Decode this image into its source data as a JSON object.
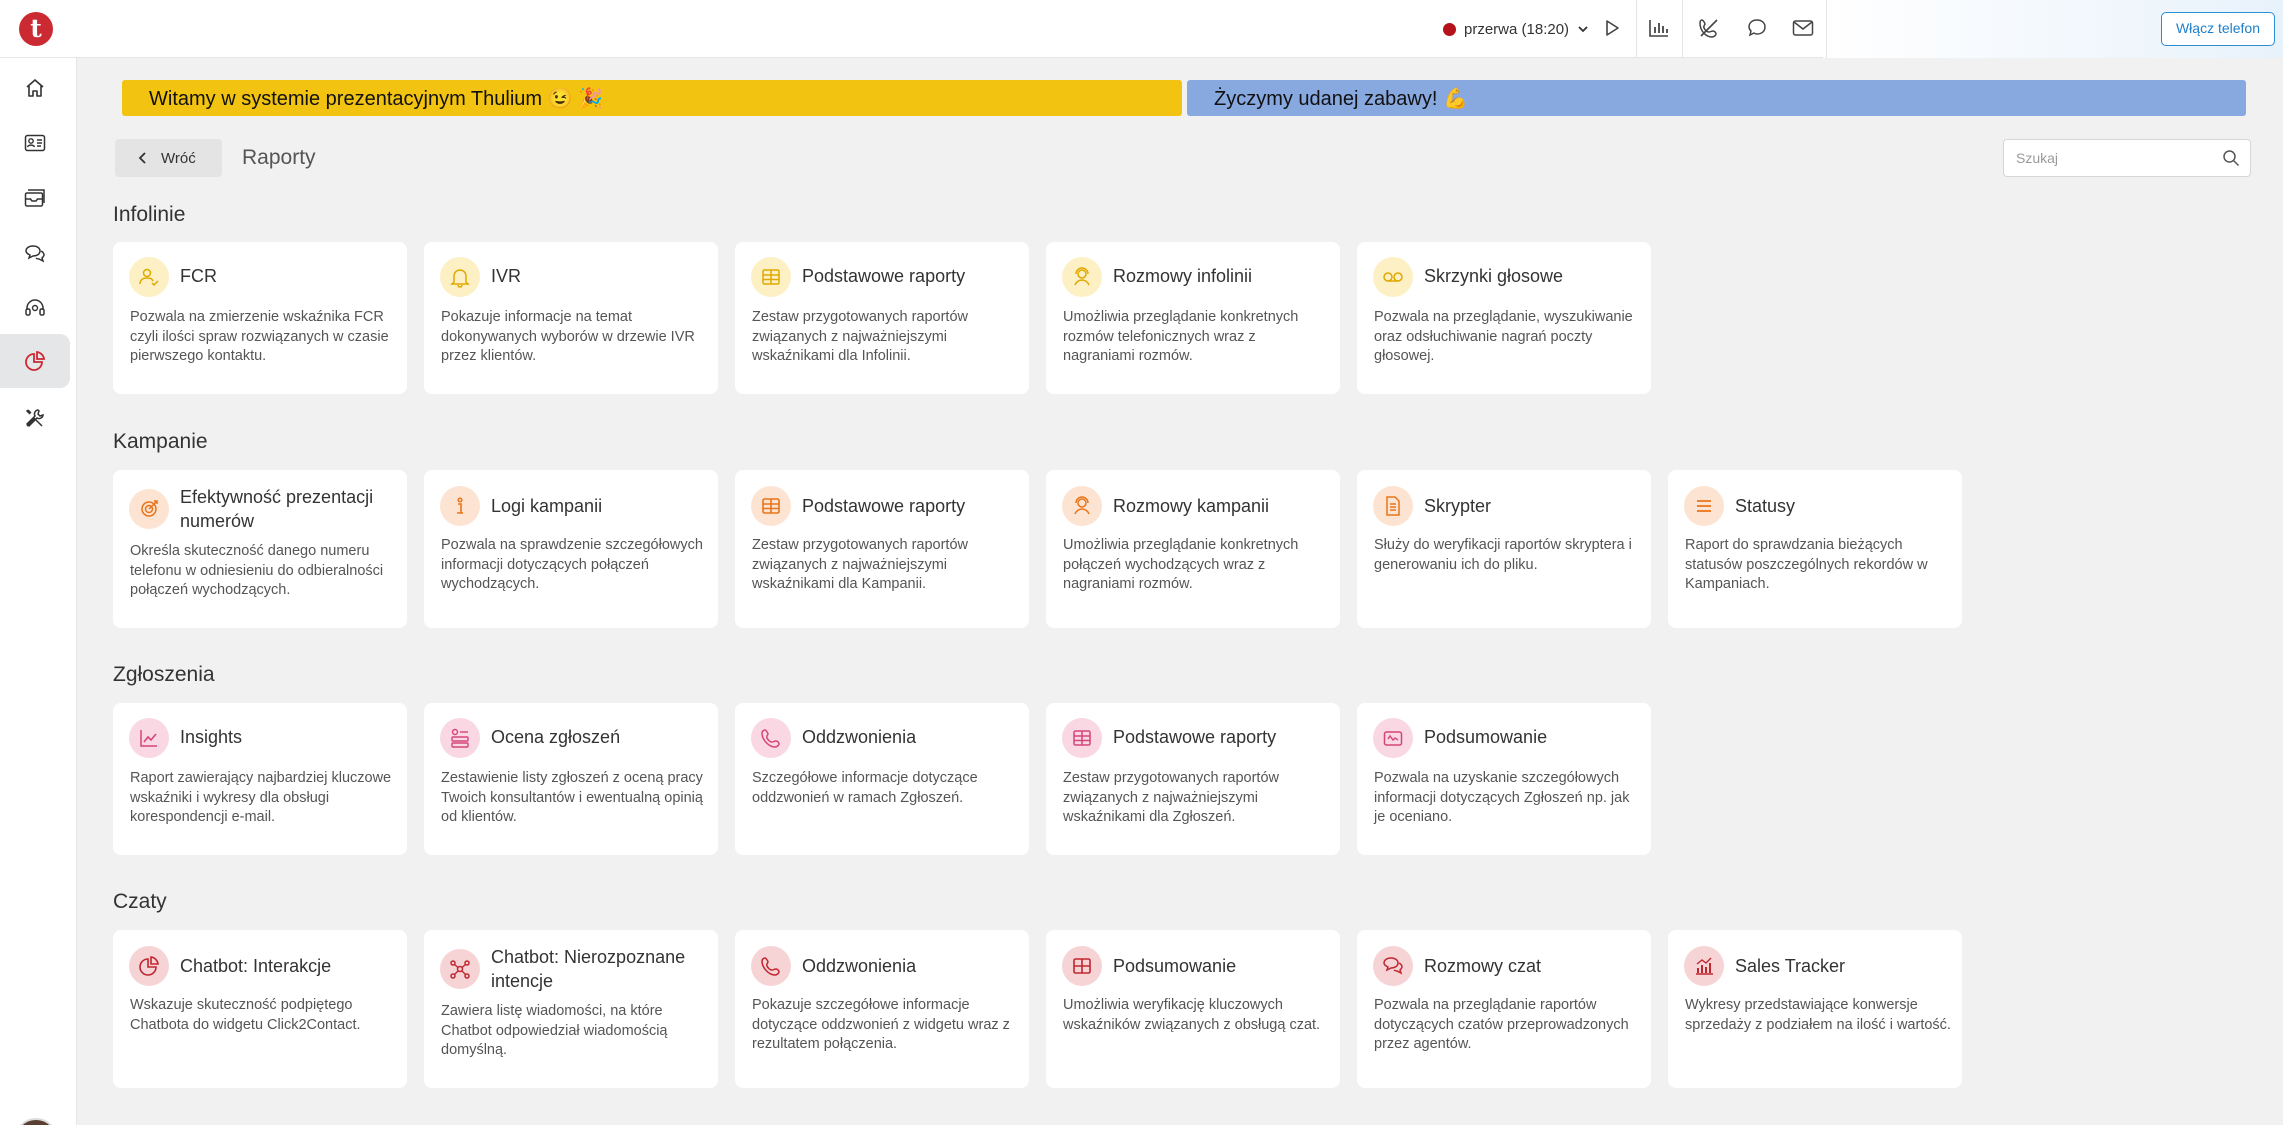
{
  "topbar": {
    "logo_letter": "t",
    "status_label": "przerwa (18:20)",
    "status_color": "#b5121b",
    "phone_button": "Włącz telefon",
    "icons": [
      "play-icon",
      "stats-icon",
      "phone-off-icon",
      "chat-icon",
      "mail-icon"
    ]
  },
  "sidebar": {
    "items": [
      "home",
      "contacts",
      "tickets",
      "chats",
      "support",
      "reports",
      "tools"
    ],
    "active": "reports"
  },
  "banners": {
    "welcome": "Witamy w systemie prezentacyjnym Thulium 😉 🎉",
    "wish": "Życzymy udanej zabawy! 💪"
  },
  "header": {
    "back_label": "Wróć",
    "title": "Raporty",
    "search_placeholder": "Szukaj"
  },
  "colors": {
    "accent": "#cc2a33",
    "banner_yellow": "#f2c310",
    "banner_blue": "#88a8e0"
  },
  "sections": [
    {
      "title": "Infolinie",
      "cards": [
        {
          "title": "FCR",
          "desc": "Pozwala na zmierzenie wskaźnika FCR czyli ilości spraw rozwiązanych w czasie pierwszego kontaktu."
        },
        {
          "title": "IVR",
          "desc": "Pokazuje informacje na temat dokonywanych wyborów w drzewie IVR przez klientów."
        },
        {
          "title": "Podstawowe raporty",
          "desc": "Zestaw przygotowanych raportów związanych z najważniejszymi wskaźnikami dla Infolinii."
        },
        {
          "title": "Rozmowy infolinii",
          "desc": "Umożliwia przeglądanie konkretnych rozmów telefonicznych wraz z nagraniami rozmów."
        },
        {
          "title": "Skrzynki głosowe",
          "desc": "Pozwala na przeglądanie, wyszukiwanie oraz odsłuchiwanie nagrań poczty głosowej."
        }
      ]
    },
    {
      "title": "Kampanie",
      "cards": [
        {
          "title": "Efektywność prezentacji numerów",
          "desc": "Określa skuteczność danego numeru telefonu w odniesieniu do odbieralności połączeń wychodzących."
        },
        {
          "title": "Logi kampanii",
          "desc": "Pozwala na sprawdzenie szczegółowych informacji dotyczących połączeń wychodzących."
        },
        {
          "title": "Podstawowe raporty",
          "desc": "Zestaw przygotowanych raportów związanych z najważniejszymi wskaźnikami dla Kampanii."
        },
        {
          "title": "Rozmowy kampanii",
          "desc": "Umożliwia przeglądanie konkretnych połączeń wychodzących wraz z nagraniami rozmów."
        },
        {
          "title": "Skrypter",
          "desc": "Służy do weryfikacji raportów skryptera i generowaniu ich do pliku."
        },
        {
          "title": "Statusy",
          "desc": "Raport do sprawdzania bieżących statusów poszczególnych rekordów w Kampaniach."
        }
      ]
    },
    {
      "title": "Zgłoszenia",
      "cards": [
        {
          "title": "Insights",
          "desc": "Raport zawierający najbardziej kluczowe wskaźniki i wykresy dla obsługi korespondencji e-mail."
        },
        {
          "title": "Ocena zgłoszeń",
          "desc": "Zestawienie listy zgłoszeń z oceną pracy Twoich konsultantów i ewentualną opinią od klientów."
        },
        {
          "title": "Oddzwonienia",
          "desc": "Szczegółowe informacje dotyczące oddzwonień w ramach Zgłoszeń."
        },
        {
          "title": "Podstawowe raporty",
          "desc": "Zestaw przygotowanych raportów związanych z najważniejszymi wskaźnikami dla Zgłoszeń."
        },
        {
          "title": "Podsumowanie",
          "desc": "Pozwala na uzyskanie szczegółowych informacji dotyczących Zgłoszeń np. jak je oceniano."
        }
      ]
    },
    {
      "title": "Czaty",
      "cards": [
        {
          "title": "Chatbot: Interakcje",
          "desc": "Wskazuje skuteczność podpiętego Chatbota do widgetu Click2Contact."
        },
        {
          "title": "Chatbot: Nierozpoznane intencje",
          "desc": "Zawiera listę wiadomości, na które Chatbot odpowiedział wiadomością domyślną."
        },
        {
          "title": "Oddzwonienia",
          "desc": "Pokazuje szczegółowe informacje dotyczące oddzwonień z widgetu wraz z rezultatem połączenia."
        },
        {
          "title": "Podsumowanie",
          "desc": "Umożliwia weryfikację kluczowych wskaźników związanych z obsługą czat."
        },
        {
          "title": "Rozmowy czat",
          "desc": "Pozwala na przeglądanie raportów dotyczących czatów przeprowadzonych przez agentów."
        },
        {
          "title": "Sales Tracker",
          "desc": "Wykresy przedstawiające konwersje sprzedaży z podziałem na ilość i wartość."
        }
      ]
    }
  ]
}
